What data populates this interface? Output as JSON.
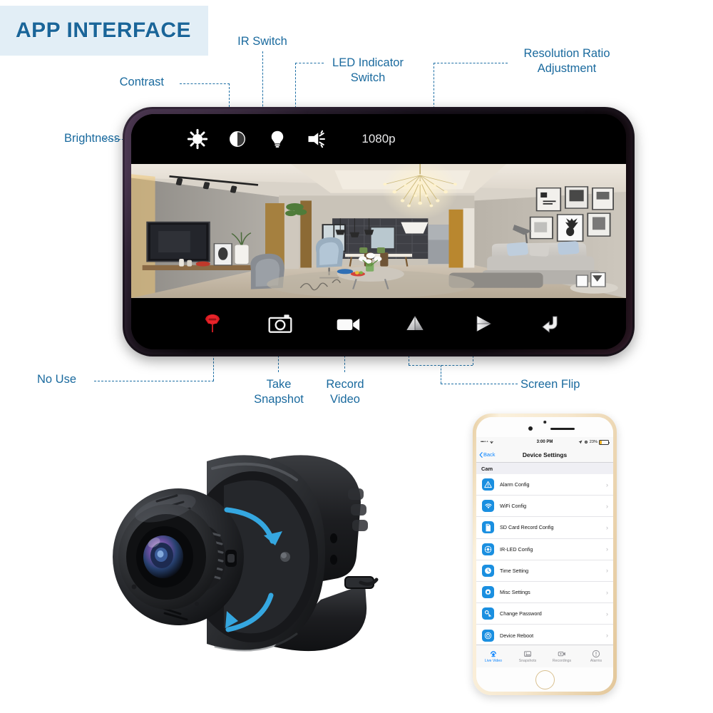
{
  "title_badge": {
    "text": "APP INTERFACE"
  },
  "colors": {
    "accent_blue": "#1a6a9e",
    "badge_bg": "#e2eef6",
    "title_blue": "#1a6599",
    "ios_blue": "#0a84ff",
    "icon_blue": "#1a8fe0",
    "record_red": "#d81a20",
    "battery_yellow": "#f0b323"
  },
  "annotations": [
    {
      "id": "brightness",
      "label": "Brightness",
      "target_icon": "sun-icon"
    },
    {
      "id": "contrast",
      "label": "Contrast",
      "target_icon": "contrast-icon"
    },
    {
      "id": "ir_switch",
      "label": "IR Switch",
      "target_icon": "bulb-icon"
    },
    {
      "id": "led_indicator",
      "label": "LED Indicator\nSwitch",
      "target_icon": "led-lamp-icon"
    },
    {
      "id": "resolution",
      "label": "Resolution Ratio\nAdjustment",
      "target_icon": "resolution-label"
    },
    {
      "id": "no_use",
      "label": "No Use",
      "target_icon": "no-use-icon"
    },
    {
      "id": "take_snapshot",
      "label": "Take\nSnapshot",
      "target_icon": "camera-icon"
    },
    {
      "id": "record_video",
      "label": "Record\nVideo",
      "target_icon": "camcorder-icon"
    },
    {
      "id": "screen_flip",
      "label": "Screen Flip",
      "target_icon": "flip-icons"
    }
  ],
  "phone_app": {
    "top_bar": {
      "icons": [
        {
          "name": "sun-icon",
          "meaning": "Brightness"
        },
        {
          "name": "contrast-icon",
          "meaning": "Contrast"
        },
        {
          "name": "bulb-icon",
          "meaning": "IR Switch"
        },
        {
          "name": "led-lamp-icon",
          "meaning": "LED Indicator Switch"
        }
      ],
      "resolution": "1080p"
    },
    "bottom_bar": {
      "icons": [
        {
          "name": "no-use-icon",
          "meaning": "No Use"
        },
        {
          "name": "camera-icon",
          "meaning": "Take Snapshot"
        },
        {
          "name": "camcorder-icon",
          "meaning": "Record Video"
        },
        {
          "name": "flip-vertical-icon",
          "meaning": "Screen Flip"
        },
        {
          "name": "flip-horizontal-icon",
          "meaning": "Screen Flip"
        },
        {
          "name": "back-arrow-icon",
          "meaning": "Back"
        }
      ]
    },
    "video_feed": {
      "description": "Live view of a modern living room"
    }
  },
  "iphone": {
    "status_bar": {
      "signal": "•••∘∘",
      "carrier_wifi": "wifi-icon",
      "time": "3:00 PM",
      "battery_percent": "23%",
      "battery_level": 23
    },
    "nav_bar": {
      "back_label": "Back",
      "title": "Device Settings"
    },
    "section_header": "Cam",
    "rows": [
      {
        "label": "Alarm Config",
        "icon": "alert-triangle-icon"
      },
      {
        "label": "WiFi Config",
        "icon": "wifi-icon"
      },
      {
        "label": "SD Card Record Config",
        "icon": "sd-card-icon"
      },
      {
        "label": "IR-LED Config",
        "icon": "ir-led-icon"
      },
      {
        "label": "Time Setting",
        "icon": "clock-icon"
      },
      {
        "label": "Misc Settings",
        "icon": "gear-icon"
      },
      {
        "label": "Change Password",
        "icon": "key-icon"
      },
      {
        "label": "Device Reboot",
        "icon": "power-icon"
      }
    ],
    "chevron": "›",
    "tabs": [
      {
        "label": "Live Video",
        "icon": "live-video-icon",
        "active": true
      },
      {
        "label": "Snapshots",
        "icon": "snapshots-icon",
        "active": false
      },
      {
        "label": "Recordings",
        "icon": "recordings-icon",
        "active": false
      },
      {
        "label": "Alarms",
        "icon": "alarms-icon",
        "active": false
      }
    ]
  },
  "product": {
    "description": "Mini wifi camera with watch strap mount and rotation arrows"
  }
}
